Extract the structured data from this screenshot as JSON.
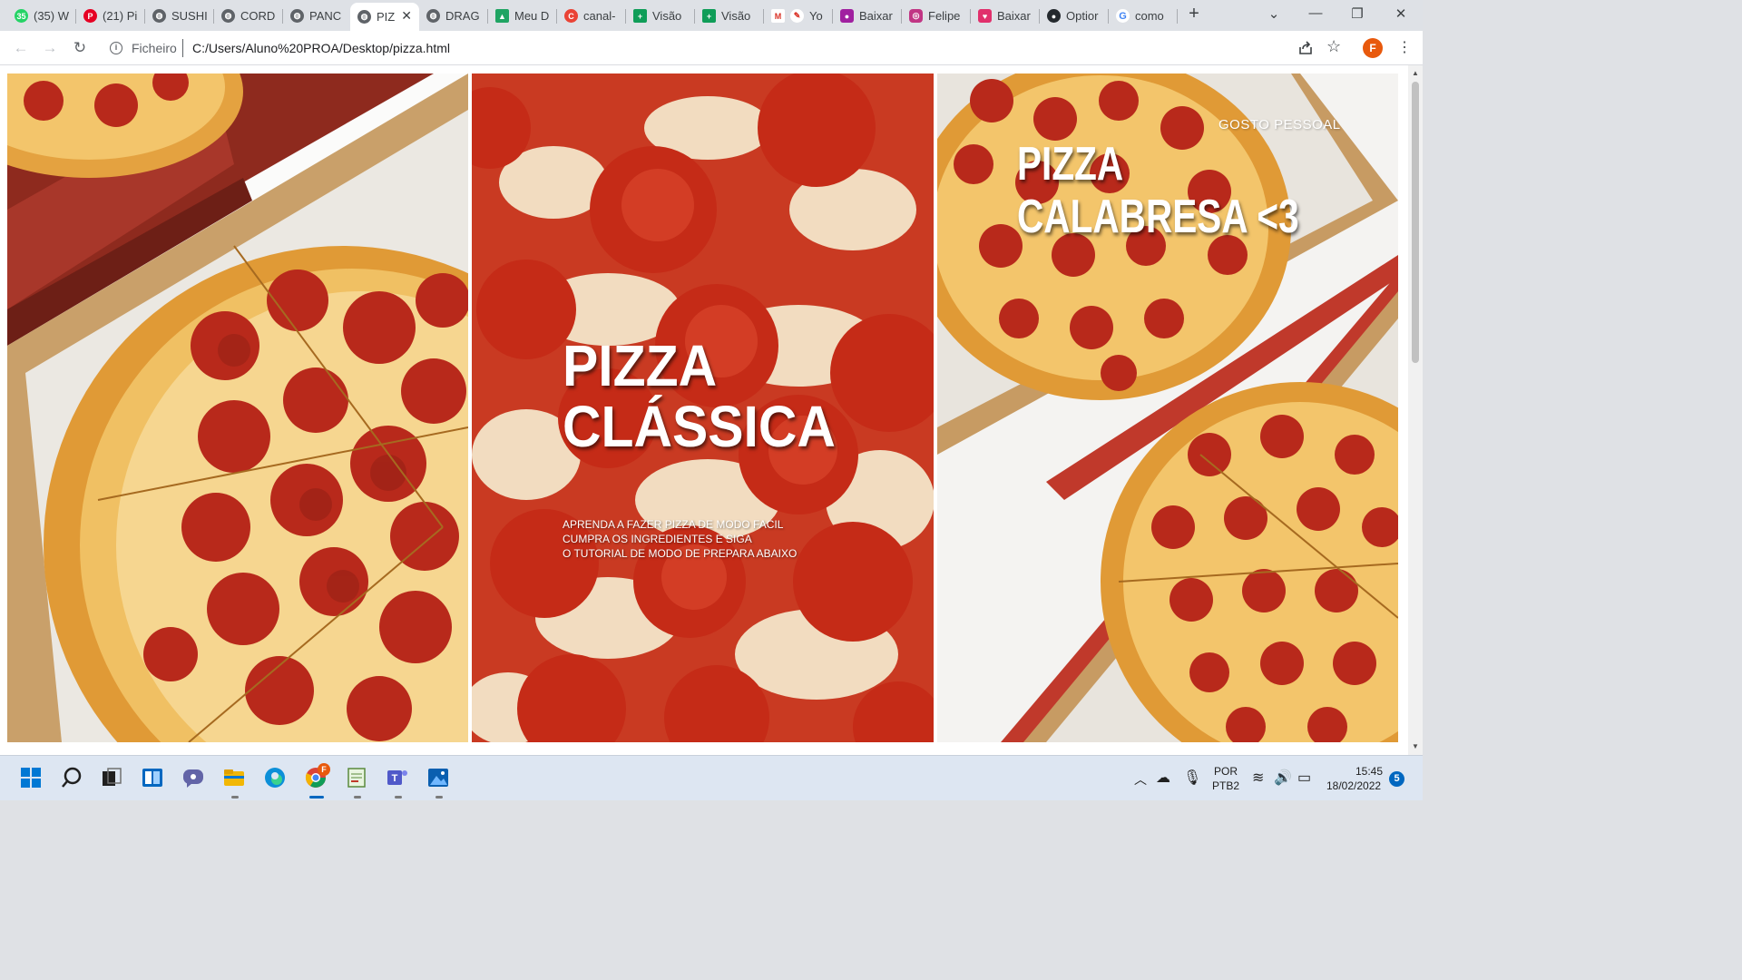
{
  "tabs": [
    {
      "label": "(35) W",
      "icon": "whatsapp-icon",
      "color": "#25d366",
      "badge": "35"
    },
    {
      "label": "(21) Pi",
      "icon": "pinterest-icon",
      "color": "#e60023",
      "badge": "P"
    },
    {
      "label": "SUSHI",
      "icon": "globe-icon",
      "color": "#5f6368",
      "badge": ""
    },
    {
      "label": "CORD",
      "icon": "globe-icon",
      "color": "#5f6368",
      "badge": ""
    },
    {
      "label": "PANC",
      "icon": "globe-icon",
      "color": "#5f6368",
      "badge": ""
    },
    {
      "label": "PIZ",
      "icon": "globe-icon",
      "color": "#5f6368",
      "badge": ""
    },
    {
      "label": "DRAG",
      "icon": "globe-icon",
      "color": "#5f6368",
      "badge": ""
    },
    {
      "label": "Meu D",
      "icon": "google-drive-icon",
      "color": "#1fa463",
      "badge": "▲"
    },
    {
      "label": "canal-",
      "icon": "canva-icon",
      "color": "#ea4335",
      "badge": "C"
    },
    {
      "label": "Visão",
      "icon": "sheets-icon",
      "color": "#0f9d58",
      "badge": "+"
    },
    {
      "label": "Visão",
      "icon": "sheets-icon",
      "color": "#0f9d58",
      "badge": "+"
    },
    {
      "label": "Yo",
      "icon": "gmail-icon",
      "color": "#d93025",
      "badge": "M"
    },
    {
      "label": "Baixar",
      "icon": "app-icon",
      "color": "#a020a0",
      "badge": "●"
    },
    {
      "label": "Felipe",
      "icon": "instagram-icon",
      "color": "#c13584",
      "badge": "◎"
    },
    {
      "label": "Baixar",
      "icon": "app-icon",
      "color": "#e1306c",
      "badge": "♥"
    },
    {
      "label": "Optior",
      "icon": "github-icon",
      "color": "#24292e",
      "badge": "●"
    },
    {
      "label": "como",
      "icon": "google-icon",
      "color": "#4285f4",
      "badge": "G"
    }
  ],
  "toolbar": {
    "scheme": "Ficheiro",
    "url": "C:/Users/Aluno%20PROA/Desktop/pizza.html",
    "profile_initial": "F"
  },
  "page": {
    "classic_title_line1": "PIZZA",
    "classic_title_line2": "CLÁSSICA",
    "classic_desc_line1": "APRENDA A FAZER PIZZA DE MODO FACIL",
    "classic_desc_line2": "CUMPRA OS INGREDIENTES E SIGA",
    "classic_desc_line3": "O TUTORIAL DE MODO DE PREPARA ABAIXO",
    "tagline": "GOSTO PESSOAL",
    "calabresa_title_line1": "PIZZA",
    "calabresa_title_line2": "CALABRESA <3"
  },
  "taskbar": {
    "lang_line1": "POR",
    "lang_line2": "PTB2",
    "time": "15:45",
    "date": "18/02/2022",
    "notification_count": "5",
    "chrome_badge": "F"
  },
  "colors": {
    "pepperoni": "#b8291b",
    "cheese": "#f3c56b",
    "crust": "#e4a240",
    "box": "#8e2a1e"
  }
}
